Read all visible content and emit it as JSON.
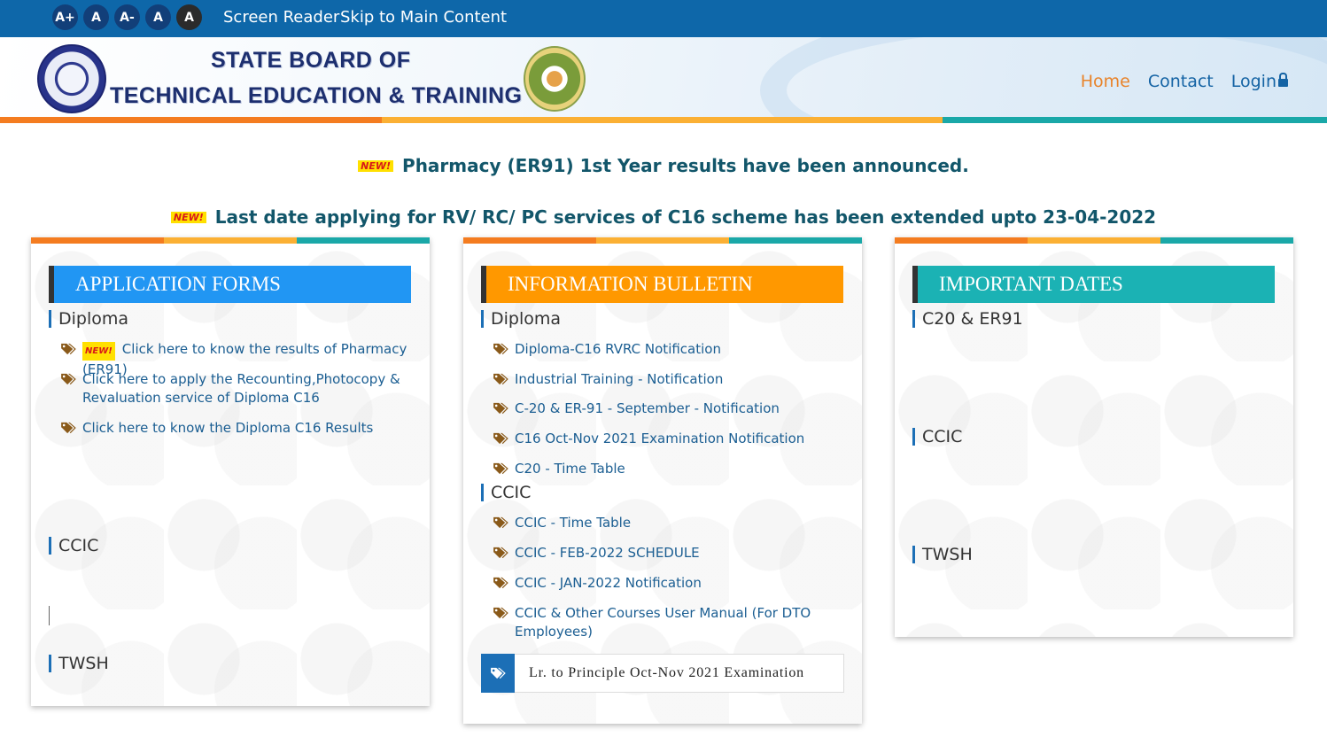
{
  "colors": {
    "topbar": "#0e67a9",
    "orange": "#f47c20",
    "yellow": "#fbb034",
    "teal": "#1aa8a8",
    "blue_title": "#2196f3",
    "orange_title": "#ff9800",
    "teal_title": "#1bb2b4"
  },
  "access": {
    "font_buttons": [
      "A+",
      "A",
      "A-",
      "A",
      "A"
    ],
    "screen_reader": "Screen Reader",
    "skip": "Skip to Main Content"
  },
  "header": {
    "line1": "STATE BOARD OF",
    "line2": "TECHNICAL EDUCATION & TRAINING",
    "nav": {
      "home": "Home",
      "contact": "Contact",
      "login": "Login"
    }
  },
  "announcements": {
    "new_badge": "NEW!",
    "a1": "Pharmacy (ER91) 1st Year results have been announced.",
    "a2": "Last date applying for RV/ RC/ PC services of C16 scheme has been extended upto 23-04-2022"
  },
  "application_forms": {
    "title": "APPLICATION FORMS",
    "diploma": "Diploma",
    "items": [
      "Click here to know the results of Pharmacy (ER91)",
      "Click here to apply the Recounting,Photocopy & Revaluation service of Diploma C16",
      "Click here to know the Diploma C16 Results"
    ],
    "ccic": "CCIC",
    "twsh": "TWSH"
  },
  "information_bulletin": {
    "title": "INFORMATION BULLETIN",
    "diploma": "Diploma",
    "diploma_items": [
      "Diploma-C16 RVRC Notification",
      "Industrial Training - Notification",
      "C-20 & ER-91 - September - Notification",
      "C16 Oct-Nov 2021 Examination Notification",
      "C20 - Time Table"
    ],
    "ccic": "CCIC",
    "ccic_items": [
      "CCIC - Time Table",
      "CCIC - FEB-2022 SCHEDULE",
      "CCIC - JAN-2022 Notification",
      "CCIC & Other Courses User Manual (For DTO Employees)"
    ],
    "box_text": "Lr. to Principle Oct-Nov 2021 Examination"
  },
  "important_dates": {
    "title": "IMPORTANT DATES",
    "s1": "C20 & ER91",
    "s2": "CCIC",
    "s3": "TWSH"
  }
}
